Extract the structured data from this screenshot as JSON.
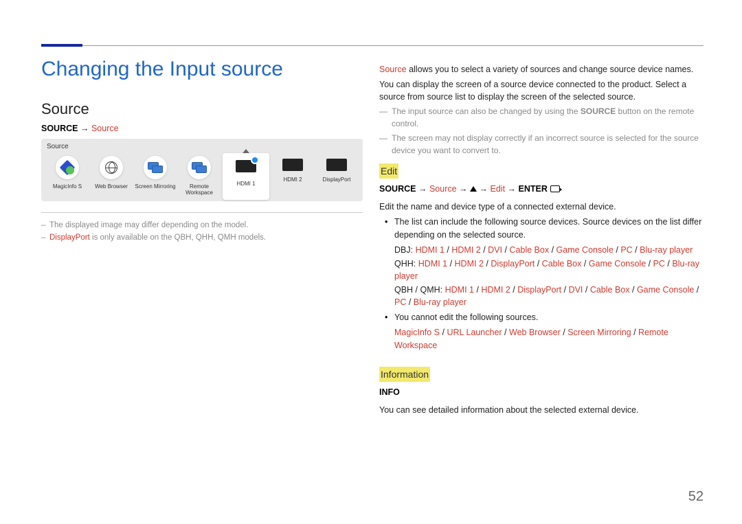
{
  "page_number": "52",
  "title": "Changing the Input source",
  "left": {
    "heading": "Source",
    "path_label": "SOURCE",
    "arrow": "→",
    "path_source": "Source",
    "panel_title": "Source",
    "items": [
      {
        "label": "MagicInfo S"
      },
      {
        "label": "Web Browser"
      },
      {
        "label": "Screen Mirroring"
      },
      {
        "label": "Remote Workspace"
      },
      {
        "label": "HDMI 1"
      },
      {
        "label": "HDMI 2"
      },
      {
        "label": "DisplayPort"
      }
    ],
    "note1": "The displayed image may differ depending on the model.",
    "note2_red": "DisplayPort",
    "note2_rest": " is only available on the QBH, QHH, QMH models."
  },
  "right": {
    "intro_red": "Source",
    "intro_rest": " allows you to select a variety of sources and change source device names.",
    "p2": "You can display the screen of a source device connected to the product. Select a source from source list to display the screen of the selected source.",
    "tnote1a": "The input source can also be changed by using the ",
    "tnote1_bold": "SOURCE",
    "tnote1b": " button on the remote control.",
    "tnote2": "The screen may not display correctly if an incorrect source is selected for the source device you want to convert to.",
    "edit_heading": "Edit",
    "edit_path": {
      "source_btn": "SOURCE",
      "arrow": "→",
      "source_red": "Source",
      "edit_red": "Edit",
      "enter": "ENTER"
    },
    "edit_desc": "Edit the name and device type of a connected external device.",
    "bullet1": "The list can include the following source devices. Source devices on the list differ depending on the selected source.",
    "dbj_label": "DBJ: ",
    "dbj_items": [
      "HDMI 1",
      "HDMI 2",
      "DVI",
      "Cable Box",
      "Game Console",
      "PC",
      "Blu-ray player"
    ],
    "qhh_label": "QHH: ",
    "qhh_items": [
      "HDMI 1",
      "HDMI 2",
      "DisplayPort",
      "Cable Box",
      "Game Console",
      "PC",
      "Blu-ray player"
    ],
    "qbh_label": "QBH / QMH: ",
    "qbh_items": [
      "HDMI 1",
      "HDMI 2",
      "DisplayPort",
      "DVI",
      "Cable Box",
      "Game Console",
      "PC",
      "Blu-ray player"
    ],
    "bullet2": "You cannot edit the following sources.",
    "noedit_items": [
      "MagicInfo S",
      "URL Launcher",
      "Web Browser",
      "Screen Mirroring",
      "Remote Workspace"
    ],
    "info_heading": "Information",
    "info_label": "INFO",
    "info_desc": "You can see detailed information about the selected external device."
  },
  "sep": " / "
}
